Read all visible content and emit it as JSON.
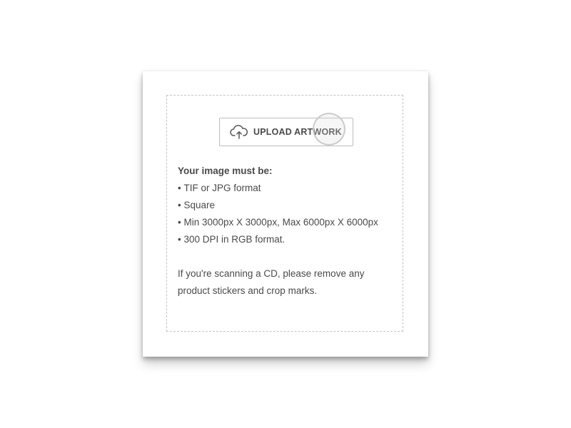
{
  "upload": {
    "button_label": "UPLOAD ARTWORK",
    "icon": "cloud-upload-icon"
  },
  "requirements": {
    "title": "Your image must be:",
    "items": [
      "TIF or JPG format",
      "Square",
      "Min 3000px X 3000px, Max 6000px X 6000px",
      "300 DPI in RGB format."
    ]
  },
  "note": "If you're scanning a CD, please remove any product stickers and crop marks.",
  "colors": {
    "text": "#4a4a4a",
    "border": "#bdbdbd",
    "dashed_border": "#c4c4c4",
    "background": "#ffffff"
  }
}
